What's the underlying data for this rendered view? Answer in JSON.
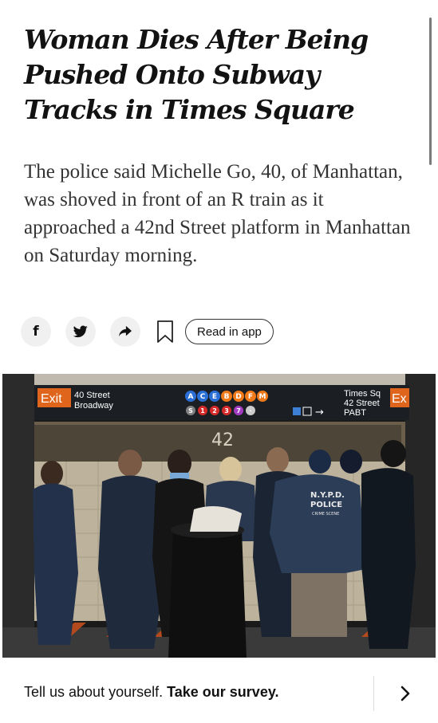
{
  "article": {
    "headline": "Woman Dies After Being Pushed Onto Subway Tracks in Times Square",
    "summary": "The police said Michelle Go, 40, of Manhattan, was shoved in front of an R train as it approached a 42nd Street platform in Manhattan on Saturday morning."
  },
  "share": {
    "facebook_icon": "facebook-icon",
    "facebook_glyph": "f",
    "twitter_icon": "twitter-icon",
    "share_icon": "share-arrow-icon",
    "bookmark_icon": "bookmark-icon",
    "read_in_app_label": "Read in app"
  },
  "photo": {
    "sign_exit_left": "Exit",
    "sign_left_line1": "40 Street",
    "sign_left_line2": "Broadway",
    "line_badges_top": [
      "A",
      "C",
      "E",
      "B",
      "D",
      "F",
      "M"
    ],
    "line_badges_bottom": [
      "S",
      "1",
      "2",
      "3",
      "7",
      "·"
    ],
    "sign_right_line1": "Times Sq",
    "sign_right_line2": "42 Street",
    "sign_right_line3": "PABT",
    "sign_exit_right": "Ex",
    "wall_number": "42",
    "vest_line1": "N.Y.P.D.",
    "vest_line2": "POLICE",
    "vest_line3": "CRIME SCENE",
    "colors": {
      "sign_bg": "#1b1f24",
      "exit_orange": "#e0651c",
      "tile_wall": "#b9ad97"
    }
  },
  "survey": {
    "prompt": "Tell us about yourself.",
    "link_label": "Take our survey.",
    "arrow_icon": "chevron-right-icon"
  }
}
